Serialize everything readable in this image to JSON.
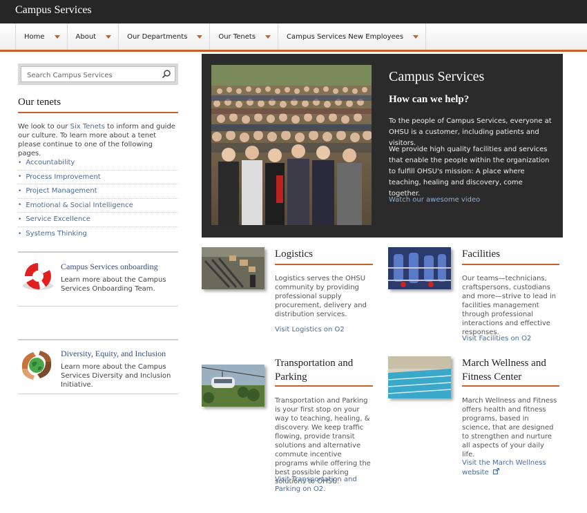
{
  "site": {
    "title": "Campus Services"
  },
  "nav": {
    "items": [
      {
        "label": "Home"
      },
      {
        "label": "About"
      },
      {
        "label": "Our Departments"
      },
      {
        "label": "Our Tenets"
      },
      {
        "label": "Campus Services New Employees"
      }
    ]
  },
  "search": {
    "placeholder": "Search Campus Services"
  },
  "tenets": {
    "title": "Our tenets",
    "intro_before": "We look to our ",
    "intro_link": "Six Tenets",
    "intro_after": " to inform and guide our culture. To learn more about a tenet please continue to one of the following pages.",
    "items": [
      "Accountability",
      "Process Improvement",
      "Project Management",
      "Emotional & Social Intelligence",
      "Service Excellence",
      "Systems Thinking"
    ]
  },
  "promos": [
    {
      "title": "Campus Services onboarding",
      "text": "Learn more about the Campus Services Onboarding Team.",
      "icon": "life-ring-icon"
    },
    {
      "title": "Diversity, Equity, and Inclusion",
      "text": "Learn more about the Campus Services Diversity and Inclusion Initiative.",
      "icon": "globe-hands-icon"
    }
  ],
  "hero": {
    "title": "Campus Services",
    "subtitle": "How can we help?",
    "p1": "To the people of Campus Services, everyone at OHSU is a customer, including patients and visitors.",
    "p2": "We provide high quality facilities and services that enable the people within the organization to fulfill OHSU's mission: A place where teaching, healing and discovery, come together.",
    "link": "Watch our awesome video"
  },
  "departments": {
    "logistics": {
      "title": "Logistics",
      "text": "Logistics serves the OHSU community by providing professional supply procurement, delivery and distribution services.",
      "link": "Visit Logistics on O2"
    },
    "facilities": {
      "title": "Facilities",
      "text": "Our teams—technicians, craftspersons, custodians and more—strive to lead in facilities management through professional interactions and effective responses.",
      "link": "Visit Facilities on O2"
    },
    "transportation": {
      "title": "Transportation and Parking",
      "text": "Transportation and Parking is your first stop on your way to teaching, healing, & discovery. We keep traffic flowing, provide transit solutions and alternative commute incentive programs while offering the best possible parking solutions to OHSU.",
      "link": "Visit Transportation and Parking on O2."
    },
    "wellness": {
      "title": "March Wellness and Fitness Center",
      "text": "March Wellness and Fitness offers health and fitness programs, based in science, that are designed to strengthen and nurture all aspects of your daily life.",
      "link": "Visit the March Wellness website"
    }
  },
  "colors": {
    "accent": "#c4602b",
    "link": "#4a6a9a",
    "topbar": "#262626",
    "hero_bg": "#2b2b2b"
  }
}
